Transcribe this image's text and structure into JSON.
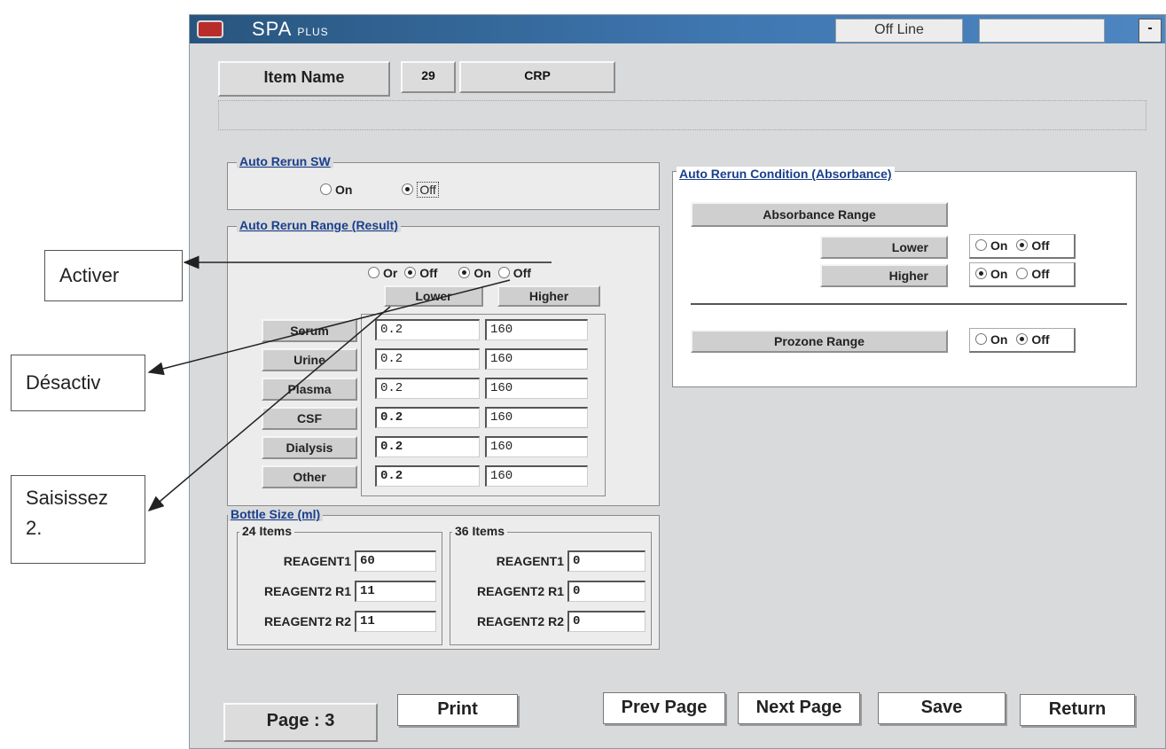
{
  "annotations": {
    "activer": "Activer",
    "desactiv": "Désactiv",
    "saisissez": "Saisissez\n2."
  },
  "window": {
    "title_main": "SPA",
    "title_sub": "PLUS",
    "status": "Off Line",
    "minimize": "-"
  },
  "item": {
    "label": "Item Name",
    "number": "29",
    "code": "CRP"
  },
  "auto_rerun_sw": {
    "title": "Auto Rerun SW",
    "on": "On",
    "off": "Off",
    "selected": "off"
  },
  "auto_rerun_range": {
    "title": "Auto Rerun Range (Result)",
    "lower_toggle": {
      "on": "Or",
      "off": "Off",
      "selected": "off"
    },
    "higher_toggle": {
      "on": "On",
      "off": "Off",
      "selected": "on"
    },
    "lower_label": "Lower",
    "higher_label": "Higher",
    "rows": [
      {
        "sample": "Serum",
        "lower": "0.2",
        "higher": "160"
      },
      {
        "sample": "Urine",
        "lower": "0.2",
        "higher": "160"
      },
      {
        "sample": "Plasma",
        "lower": "0.2",
        "higher": "160"
      },
      {
        "sample": "CSF",
        "lower": "0.2",
        "higher": "160"
      },
      {
        "sample": "Dialysis",
        "lower": "0.2",
        "higher": "160"
      },
      {
        "sample": "Other",
        "lower": "0.2",
        "higher": "160"
      }
    ]
  },
  "bottle_size": {
    "title": "Bottle Size (ml)",
    "group24": {
      "title": "24 Items",
      "rows": [
        {
          "label": "REAGENT1",
          "value": "60"
        },
        {
          "label": "REAGENT2 R1",
          "value": "11"
        },
        {
          "label": "REAGENT2 R2",
          "value": "11"
        }
      ]
    },
    "group36": {
      "title": "36 Items",
      "rows": [
        {
          "label": "REAGENT1",
          "value": "0"
        },
        {
          "label": "REAGENT2 R1",
          "value": "0"
        },
        {
          "label": "REAGENT2 R2",
          "value": "0"
        }
      ]
    }
  },
  "condition": {
    "title": "Auto Rerun Condition (Absorbance)",
    "absorbance_range": "Absorbance Range",
    "lower": {
      "label": "Lower",
      "on": "On",
      "off": "Off",
      "selected": "off"
    },
    "higher": {
      "label": "Higher",
      "on": "On",
      "off": "Off",
      "selected": "on"
    },
    "prozone": {
      "label": "Prozone Range",
      "on": "On",
      "off": "Off",
      "selected": "off"
    }
  },
  "footer": {
    "page": "Page  :  3",
    "print": "Print",
    "prev": "Prev Page",
    "next": "Next Page",
    "save": "Save",
    "return": "Return"
  }
}
